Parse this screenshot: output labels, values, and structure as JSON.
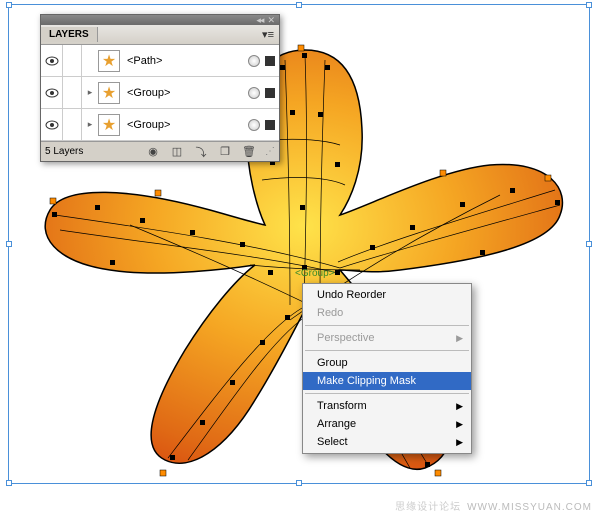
{
  "panel": {
    "title": "LAYERS",
    "rows": [
      {
        "name": "<Path>",
        "icon": "★",
        "expand": ""
      },
      {
        "name": "<Group>",
        "icon": "★",
        "expand": "▸"
      },
      {
        "name": "<Group>",
        "icon": "★",
        "expand": "▸"
      }
    ],
    "footer": "5 Layers"
  },
  "context_menu": {
    "hint": "<Group>",
    "items": [
      {
        "label": "Undo Reorder",
        "enabled": true
      },
      {
        "label": "Redo",
        "enabled": false
      },
      {
        "sep": true
      },
      {
        "label": "Perspective",
        "enabled": false,
        "submenu": true
      },
      {
        "sep": true
      },
      {
        "label": "Group",
        "enabled": true
      },
      {
        "label": "Make Clipping Mask",
        "enabled": true,
        "highlight": true
      },
      {
        "sep": true
      },
      {
        "label": "Transform",
        "enabled": true,
        "submenu": true
      },
      {
        "label": "Arrange",
        "enabled": true,
        "submenu": true
      },
      {
        "label": "Select",
        "enabled": true,
        "submenu": true
      }
    ]
  },
  "watermark": {
    "cn": "思缘设计论坛",
    "en": "WWW.MISSYUAN.COM"
  },
  "colors": {
    "accent": "#316ac5",
    "star_grad_a": "#ffe34a",
    "star_grad_b": "#f08b1c",
    "star_grad_c": "#d94e10"
  }
}
